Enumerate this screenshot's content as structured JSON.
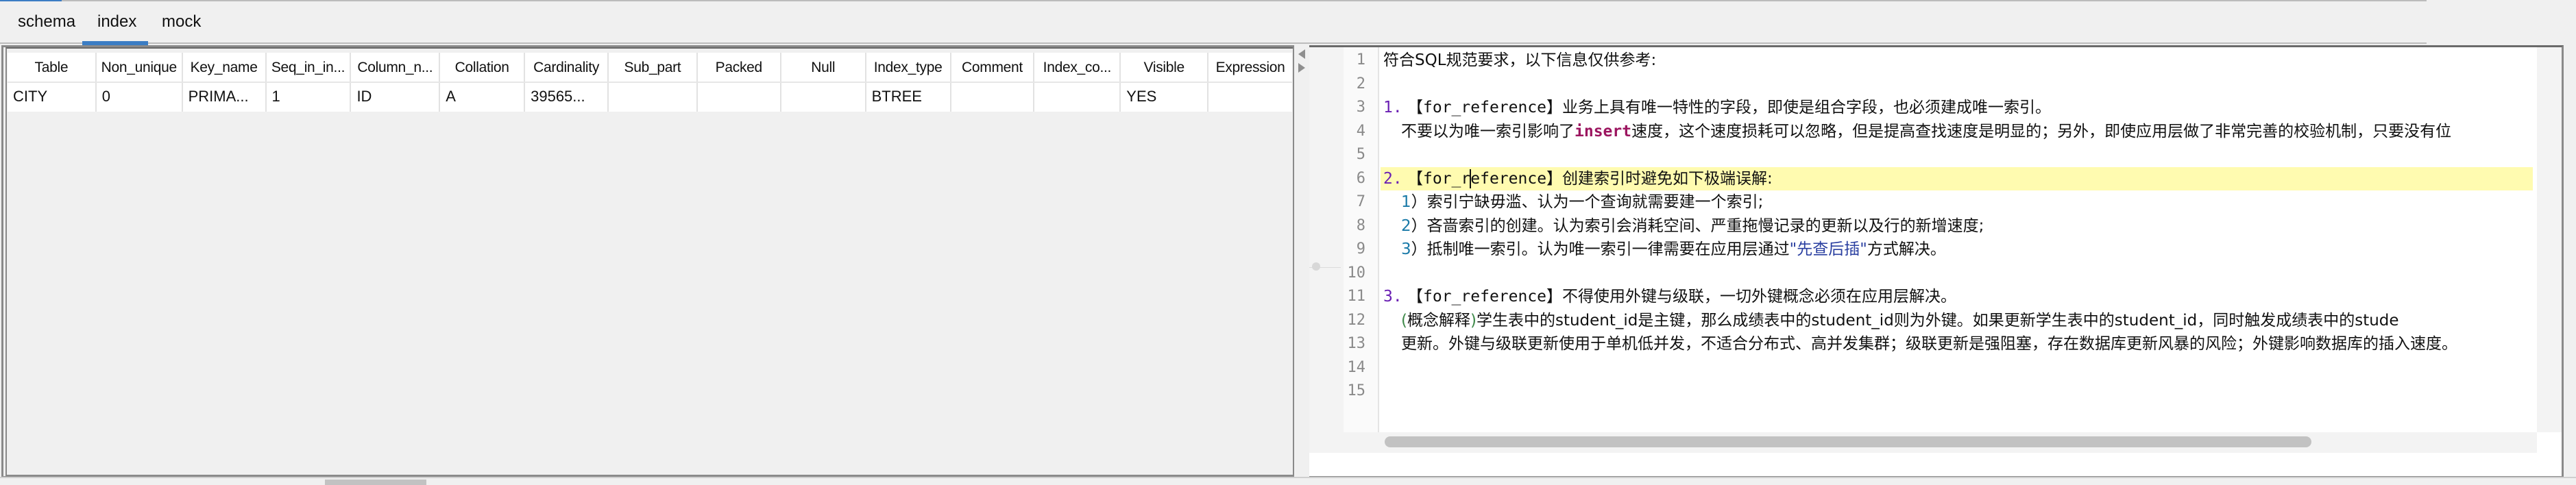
{
  "tabs": [
    {
      "label": "schema",
      "active": false
    },
    {
      "label": "index",
      "active": true
    },
    {
      "label": "mock",
      "active": false
    }
  ],
  "colors": {
    "accent": "#3b7dc4",
    "highlight_line": "#fffbb0",
    "list_number": "#6a1fb3",
    "sub_number": "#1a7aa8",
    "keyword": "#9c1660",
    "string": "#2a3fa0",
    "paren": "#3f8a4a"
  },
  "index_table": {
    "columns": [
      "Table",
      "Non_unique",
      "Key_name",
      "Seq_in_in...",
      "Column_n...",
      "Collation",
      "Cardinality",
      "Sub_part",
      "Packed",
      "Null",
      "Index_type",
      "Comment",
      "Index_co...",
      "Visible",
      "Expression"
    ],
    "rows": [
      [
        "CITY",
        "0",
        "PRIMA...",
        "1",
        "ID",
        "A",
        "39565...",
        "",
        "",
        "",
        "BTREE",
        "",
        "",
        "YES",
        ""
      ]
    ]
  },
  "editor": {
    "line_numbers": [
      "1",
      "2",
      "3",
      "4",
      "5",
      "6",
      "7",
      "8",
      "9",
      "10",
      "11",
      "12",
      "13",
      "14",
      "15"
    ],
    "lines": {
      "l1": "符合SQL规范要求，以下信息仅供参考:",
      "l3_num": "1.",
      "l3_tag": "【for_reference】",
      "l3_text": "业务上具有唯一特性的字段，即使是组合字段，也必须建成唯一索引。",
      "l4_pre": "不要以为唯一索引影响了",
      "l4_kw": "insert",
      "l4_post": "速度，这个速度损耗可以忽略，但是提高查找速度是明显的；另外，即使应用层做了非常完善的校验机制，只要没有位",
      "l6_num": "2.",
      "l6_tag_a": "【for_r",
      "l6_tag_b": "eference】",
      "l6_text": "创建索引时避免如下极端误解:",
      "l7_num": "1",
      "l7_text": "）索引宁缺毋滥、认为一个查询就需要建一个索引;",
      "l8_num": "2",
      "l8_text": "）吝啬索引的创建。认为索引会消耗空间、严重拖慢记录的更新以及行的新增速度;",
      "l9_num": "3",
      "l9_pre": "）抵制唯一索引。认为唯一索引一律需要在应用层通过",
      "l9_str": "\"先查后插\"",
      "l9_post": "方式解决。",
      "l11_num": "3.",
      "l11_tag": "【for_reference】",
      "l11_text": "不得使用外键与级联，一切外键概念必须在应用层解决。",
      "l12_paren_open": "(",
      "l12_paren_text": "概念解释",
      "l12_paren_close": ")",
      "l12_text": "学生表中的student_id是主键，那么成绩表中的student_id则为外键。如果更新学生表中的student_id，同时触发成绩表中的stude",
      "l13_text": "更新。外键与级联更新使用于单机低并发，不适合分布式、高并发集群；级联更新是强阻塞，存在数据库更新风暴的风险；外键影响数据库的插入速度。"
    }
  }
}
